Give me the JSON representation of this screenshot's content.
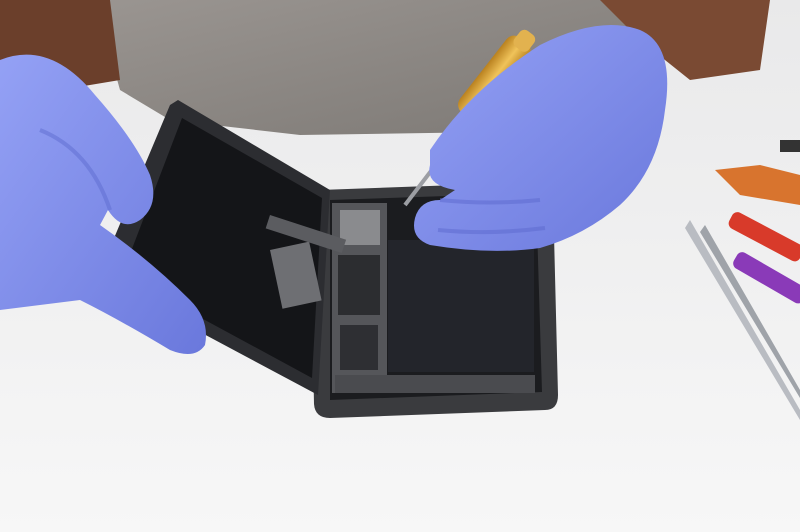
{
  "scene": {
    "subject": "smartphone-repair",
    "colors": {
      "table": "#f4f4f4",
      "shirt": "#8f8a86",
      "skin": "#7a4a33",
      "glove": "#7f8ff0",
      "glove_shadow": "#5e6bd0",
      "phone_frame": "#3a3b3e",
      "phone_internal": "#1b1c1f",
      "battery": "#23252b",
      "screwdriver_gold": "#d8a23a",
      "tool_orange": "#e06a2a",
      "tool_red": "#d83a2a",
      "tool_purple": "#8a3ab8",
      "tweezers": "#b9bcc2"
    }
  }
}
